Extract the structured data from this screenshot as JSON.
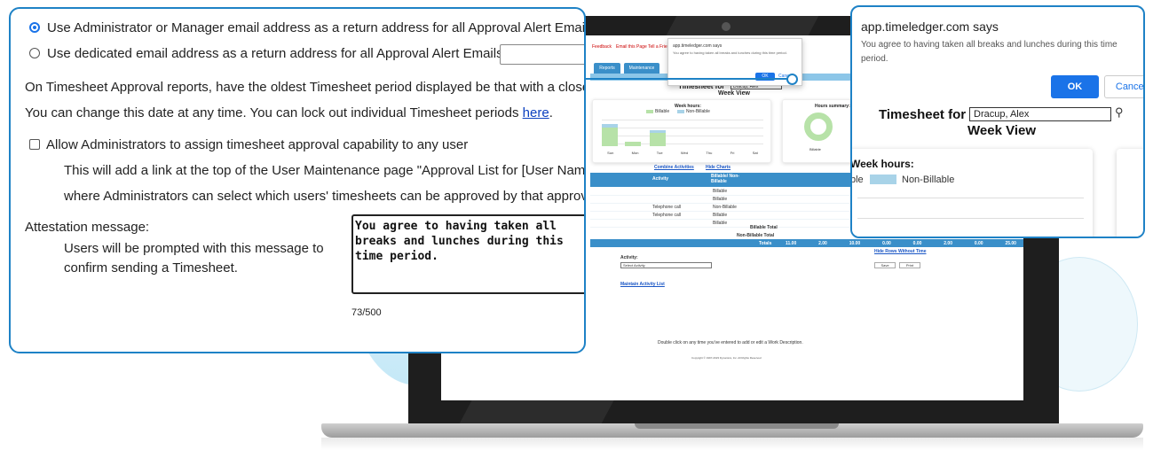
{
  "settings": {
    "radio_admin_label": "Use Administrator or Manager email address as a return address for all Approval Alert Emails",
    "radio_dedicated_label": "Use dedicated email address as a return address for all Approval Alert Emails:",
    "dedicated_email_value": "",
    "oldest_period_text": "On Timesheet Approval reports, have the oldest Timesheet period displayed be that with a closeou",
    "change_date_text": "You can change this date at any time. You can lock out individual Timesheet periods ",
    "here_link": "here",
    "period_mark": ".",
    "allow_admin_label": "Allow Administrators to assign timesheet approval capability to any user",
    "allow_admin_desc1": "This will add a link at the top of the User Maintenance page \"Approval List for [User Name]\"",
    "allow_admin_desc2": "where Administrators can select which users' timesheets can be approved by that approving",
    "attestation_label": "Attestation message:",
    "attestation_desc1": "Users will be prompted with this message to",
    "attestation_desc2": "confirm sending a Timesheet.",
    "attestation_value": "You agree to having taken all breaks and lunches during this time period.",
    "char_count": "73/500"
  },
  "dialog": {
    "origin": "app.timeledger.com says",
    "message": "You agree to having taken all breaks and lunches during this time period.",
    "ok_label": "OK",
    "cancel_label": "Cancel",
    "page_title": "Timesheet for",
    "user_selected": "Dracup, Alex",
    "week_view": "Week View",
    "week_hours": "Week hours:",
    "legend_billable": "ble",
    "legend_nonbillable": "Non-Billable"
  },
  "mini": {
    "nav_feedback": "Feedback",
    "nav_email": "Email this Page",
    "nav_tell": "Tell a Friend",
    "alert_origin": "app.timeledger.com says",
    "alert_message": "You agree to having taken all breaks and lunches during this time period.",
    "alert_ok": "OK",
    "alert_cancel": "Cancel",
    "tab_reports": "Reports",
    "tab_maintenance": "Maintenance",
    "title": "Timesheet for",
    "user_selected": "Dracup, Alex",
    "week_view": "Week View",
    "week_hours": "Week hours:",
    "hours_summary": "Hours summary:",
    "legend_billable": "Billable",
    "legend_nonbillable": "Non-Billable",
    "days": [
      "Sun",
      "Mon",
      "Tue",
      "Wed",
      "Thu",
      "Fri",
      "Sat"
    ],
    "combine_link": "Combine Activities",
    "hide_charts": "Hide Charts",
    "col_activity": "Activity",
    "col_billable": "Billable/ Non-Billable",
    "rows": [
      {
        "activity": "",
        "type": "Billable"
      },
      {
        "activity": "",
        "type": "Billable"
      },
      {
        "activity": "Telephone call",
        "type": "Non-Billable"
      },
      {
        "activity": "Telephone call",
        "type": "Billable"
      },
      {
        "activity": "",
        "type": "Billable"
      }
    ],
    "billable_total": "Billable Total",
    "nonbillable_total": "Non-Billable Total",
    "totals": "Totals",
    "total_values": [
      "11.00",
      "2.00",
      "10.00",
      "0.00",
      "0.00",
      "2.00",
      "0.00",
      "25.00"
    ],
    "activity_label": "Activity:",
    "select_activity": "Select Activity",
    "hide_rows": "Hide Rows Without Time",
    "save": "Save",
    "print": "Print",
    "maintain_link": "Maintain Activity List",
    "hint": "Double click on any time you've entered to add or edit a Work Description.",
    "copyright": "Copyright © 1997-2023 Dynamics, Inc. All Rights Reserved"
  },
  "colors": {
    "accent": "#1e82c6",
    "button": "#1a73e8",
    "bar_billable": "#b7e2a8",
    "bar_nonbillable": "#a8d3e8"
  }
}
